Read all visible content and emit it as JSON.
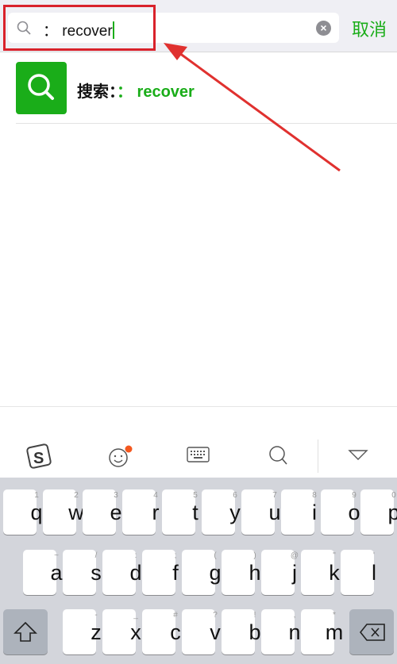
{
  "search": {
    "prefix": "：",
    "value": "recover",
    "cancel_label": "取消"
  },
  "result": {
    "label": "搜索：",
    "query": "： recover"
  },
  "colors": {
    "accent": "#1aad19",
    "annotation": "#d9222b",
    "badge": "#f4581f"
  },
  "toolbar": {
    "icons": [
      "sogou-logo-icon",
      "emoji-icon",
      "keyboard-icon",
      "search-icon",
      "collapse-triangle-icon"
    ]
  },
  "keyboard": {
    "row1": [
      {
        "k": "q",
        "s": "1"
      },
      {
        "k": "w",
        "s": "2"
      },
      {
        "k": "e",
        "s": "3"
      },
      {
        "k": "r",
        "s": "4"
      },
      {
        "k": "t",
        "s": "5"
      },
      {
        "k": "y",
        "s": "6"
      },
      {
        "k": "u",
        "s": "7"
      },
      {
        "k": "i",
        "s": "8"
      },
      {
        "k": "o",
        "s": "9"
      },
      {
        "k": "p",
        "s": "0"
      }
    ],
    "row2": [
      {
        "k": "a",
        "s": "~"
      },
      {
        "k": "s",
        "s": "/"
      },
      {
        "k": "d",
        "s": ":"
      },
      {
        "k": "f",
        "s": ";"
      },
      {
        "k": "g",
        "s": "("
      },
      {
        "k": "h",
        "s": ")"
      },
      {
        "k": "j",
        "s": "@"
      },
      {
        "k": "k",
        "s": "\""
      },
      {
        "k": "l",
        "s": "'"
      }
    ],
    "row3": [
      {
        "k": "z",
        "s": "-"
      },
      {
        "k": "x",
        "s": "_"
      },
      {
        "k": "c",
        "s": "#"
      },
      {
        "k": "v",
        "s": "?"
      },
      {
        "k": "b",
        "s": "!"
      },
      {
        "k": "n",
        "s": ","
      },
      {
        "k": "m",
        "s": "*"
      }
    ]
  }
}
